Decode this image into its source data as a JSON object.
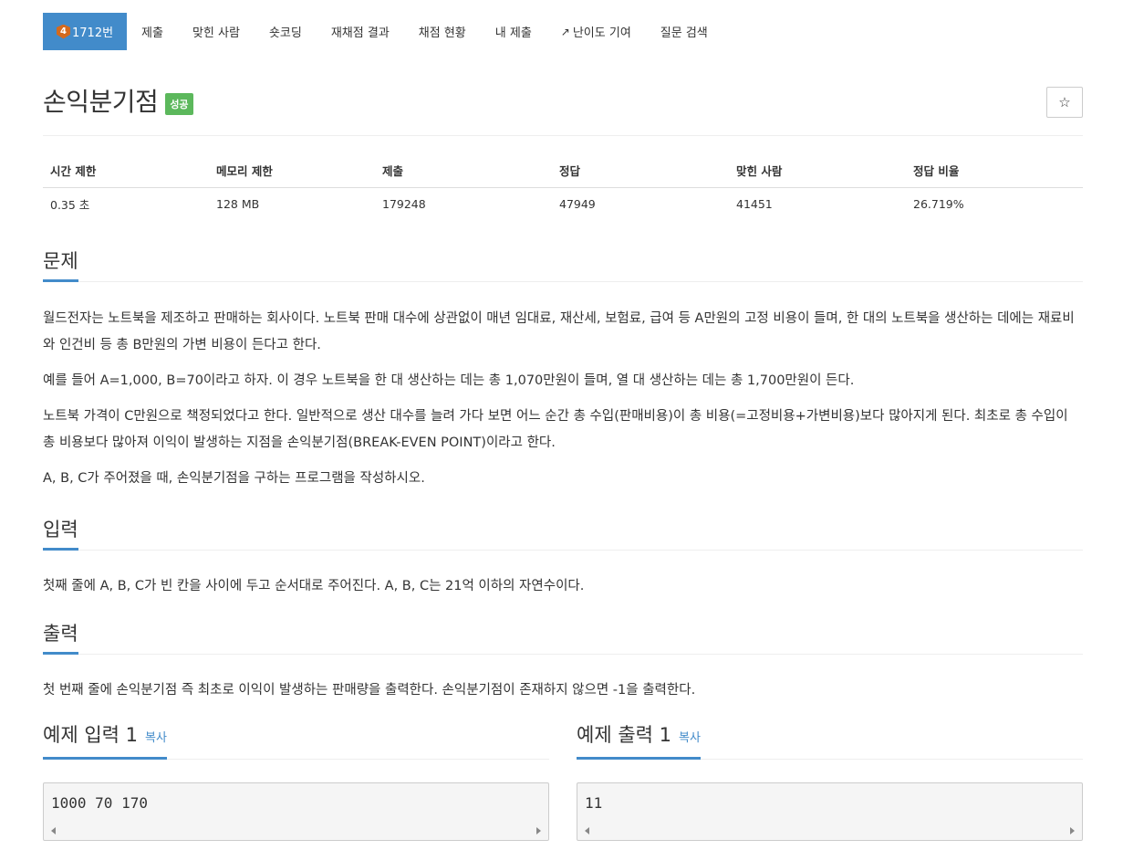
{
  "nav": {
    "tier": "4",
    "problem_number": "1712번",
    "items": [
      "제출",
      "맞힌 사람",
      "숏코딩",
      "재채점 결과",
      "채점 현황",
      "내 제출",
      "난이도 기여",
      "질문 검색"
    ]
  },
  "problem": {
    "title": "손익분기점",
    "status": "성공",
    "star_icon": "☆"
  },
  "info_table": {
    "headers": [
      "시간 제한",
      "메모리 제한",
      "제출",
      "정답",
      "맞힌 사람",
      "정답 비율"
    ],
    "values": [
      "0.35 초",
      "128 MB",
      "179248",
      "47949",
      "41451",
      "26.719%"
    ]
  },
  "sections": {
    "description": {
      "title": "문제",
      "paragraphs": [
        "월드전자는 노트북을 제조하고 판매하는 회사이다. 노트북 판매 대수에 상관없이 매년 임대료, 재산세, 보험료, 급여 등 A만원의 고정 비용이 들며, 한 대의 노트북을 생산하는 데에는 재료비와 인건비 등 총 B만원의 가변 비용이 든다고 한다.",
        "예를 들어 A=1,000, B=70이라고 하자. 이 경우 노트북을 한 대 생산하는 데는 총 1,070만원이 들며, 열 대 생산하는 데는 총 1,700만원이 든다.",
        "노트북 가격이 C만원으로 책정되었다고 한다. 일반적으로 생산 대수를 늘려 가다 보면 어느 순간 총 수입(판매비용)이 총 비용(=고정비용+가변비용)보다 많아지게 된다. 최초로 총 수입이 총 비용보다 많아져 이익이 발생하는 지점을 손익분기점(BREAK-EVEN POINT)이라고 한다.",
        "A, B, C가 주어졌을 때, 손익분기점을 구하는 프로그램을 작성하시오."
      ]
    },
    "input": {
      "title": "입력",
      "text": "첫째 줄에 A, B, C가 빈 칸을 사이에 두고 순서대로 주어진다. A, B, C는 21억 이하의 자연수이다."
    },
    "output": {
      "title": "출력",
      "text": "첫 번째 줄에 손익분기점 즉 최초로 이익이 발생하는 판매량을 출력한다. 손익분기점이 존재하지 않으면 -1을 출력한다."
    }
  },
  "samples": {
    "input": {
      "title": "예제 입력 1",
      "copy_label": "복사",
      "code": "1000 70 170"
    },
    "output": {
      "title": "예제 출력 1",
      "copy_label": "복사",
      "code": "11"
    }
  }
}
